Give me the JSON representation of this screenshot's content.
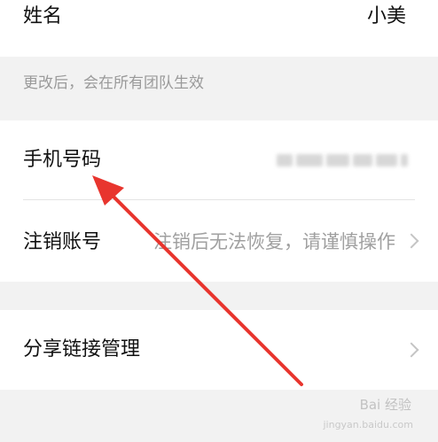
{
  "name_row": {
    "label": "姓名",
    "value": "小美"
  },
  "section_hint": "更改后，会在所有团队生效",
  "phone_row": {
    "label": "手机号码"
  },
  "cancel_row": {
    "label": "注销账号",
    "hint": "注销后无法恢复，请谨慎操作"
  },
  "share_row": {
    "label": "分享链接管理"
  },
  "watermark": {
    "brand": "Bai 经验",
    "url": "jingyan.baidu.com"
  },
  "colors": {
    "annotation_arrow": "#e8352e",
    "background": "#f2f2f2",
    "row": "#ffffff"
  }
}
